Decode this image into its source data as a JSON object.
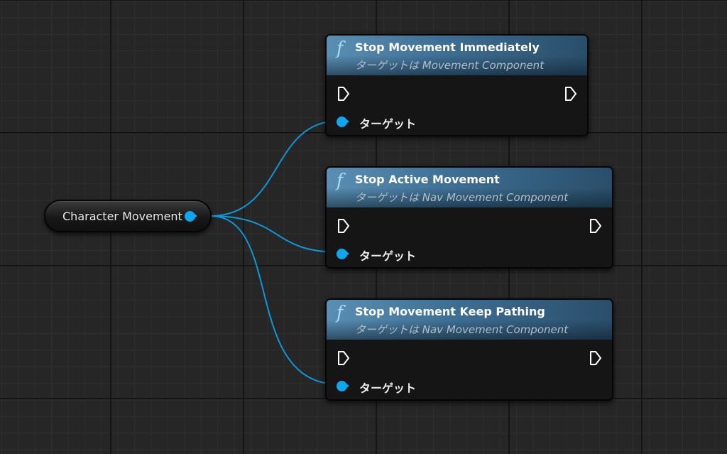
{
  "variable_node": {
    "label": "Character Movement"
  },
  "function_nodes": [
    {
      "title": "Stop Movement Immediately",
      "subtitle": "ターゲットは Movement Component",
      "icon": "function-icon",
      "pin_label": "ターゲット"
    },
    {
      "title": "Stop Active Movement",
      "subtitle": "ターゲットは Nav Movement Component",
      "icon": "function-icon",
      "pin_label": "ターゲット"
    },
    {
      "title": "Stop Movement Keep Pathing",
      "subtitle": "ターゲットは Nav Movement Component",
      "icon": "function-icon",
      "pin_label": "ターゲット"
    }
  ],
  "function_glyph": "f",
  "colors": {
    "wire": "#0e97d8",
    "object_pin": "#0ea6ec",
    "header_start": "#5a8fb3",
    "header_end": "#2a4e6a",
    "node_body": "#151515",
    "grid_background": "#262626"
  }
}
